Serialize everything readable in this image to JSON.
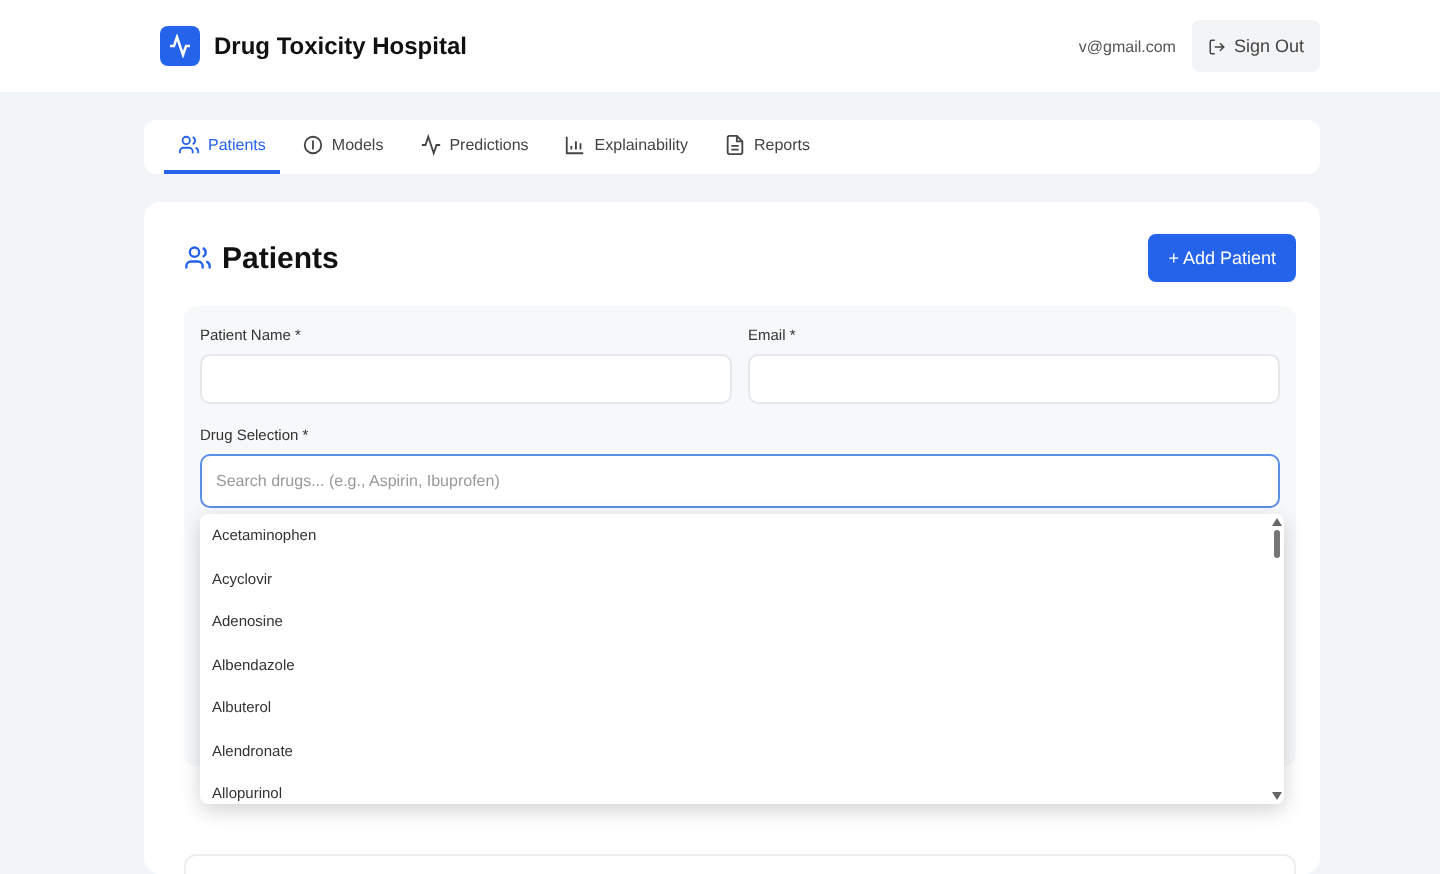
{
  "header": {
    "title": "Drug Toxicity Hospital",
    "user_email": "v@gmail.com",
    "sign_out": "Sign Out"
  },
  "tabs": [
    {
      "label": "Patients",
      "selected": true
    },
    {
      "label": "Models",
      "selected": false
    },
    {
      "label": "Predictions",
      "selected": false
    },
    {
      "label": "Explainability",
      "selected": false
    },
    {
      "label": "Reports",
      "selected": false
    }
  ],
  "section": {
    "title": "Patients",
    "add_button": "+ Add Patient"
  },
  "form": {
    "patient_name": {
      "label": "Patient Name *"
    },
    "email": {
      "label": "Email *"
    },
    "drug_selection": {
      "label": "Drug Selection *",
      "placeholder": "Search drugs... (e.g., Aspirin, Ibuprofen)"
    }
  },
  "drug_options": [
    "Acetaminophen",
    "Acyclovir",
    "Adenosine",
    "Albendazole",
    "Albuterol",
    "Alendronate",
    "Allopurinol"
  ]
}
